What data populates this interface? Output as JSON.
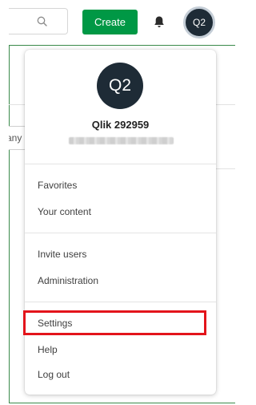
{
  "header": {
    "search_icon": "search-icon",
    "create_label": "Create",
    "notifications_icon": "bell-icon",
    "avatar_initials": "Q2"
  },
  "background": {
    "fragment_text": "any"
  },
  "user_menu": {
    "avatar_initials": "Q2",
    "user_name": "Qlik 292959",
    "items": [
      {
        "label": "Favorites"
      },
      {
        "label": "Your content"
      },
      {
        "label": "Invite users"
      },
      {
        "label": "Administration"
      },
      {
        "label": "Settings"
      },
      {
        "label": "Help"
      },
      {
        "label": "Log out"
      }
    ]
  },
  "colors": {
    "accent_green": "#009845",
    "avatar_dark": "#1e2b36",
    "highlight_red": "#e3141b"
  }
}
